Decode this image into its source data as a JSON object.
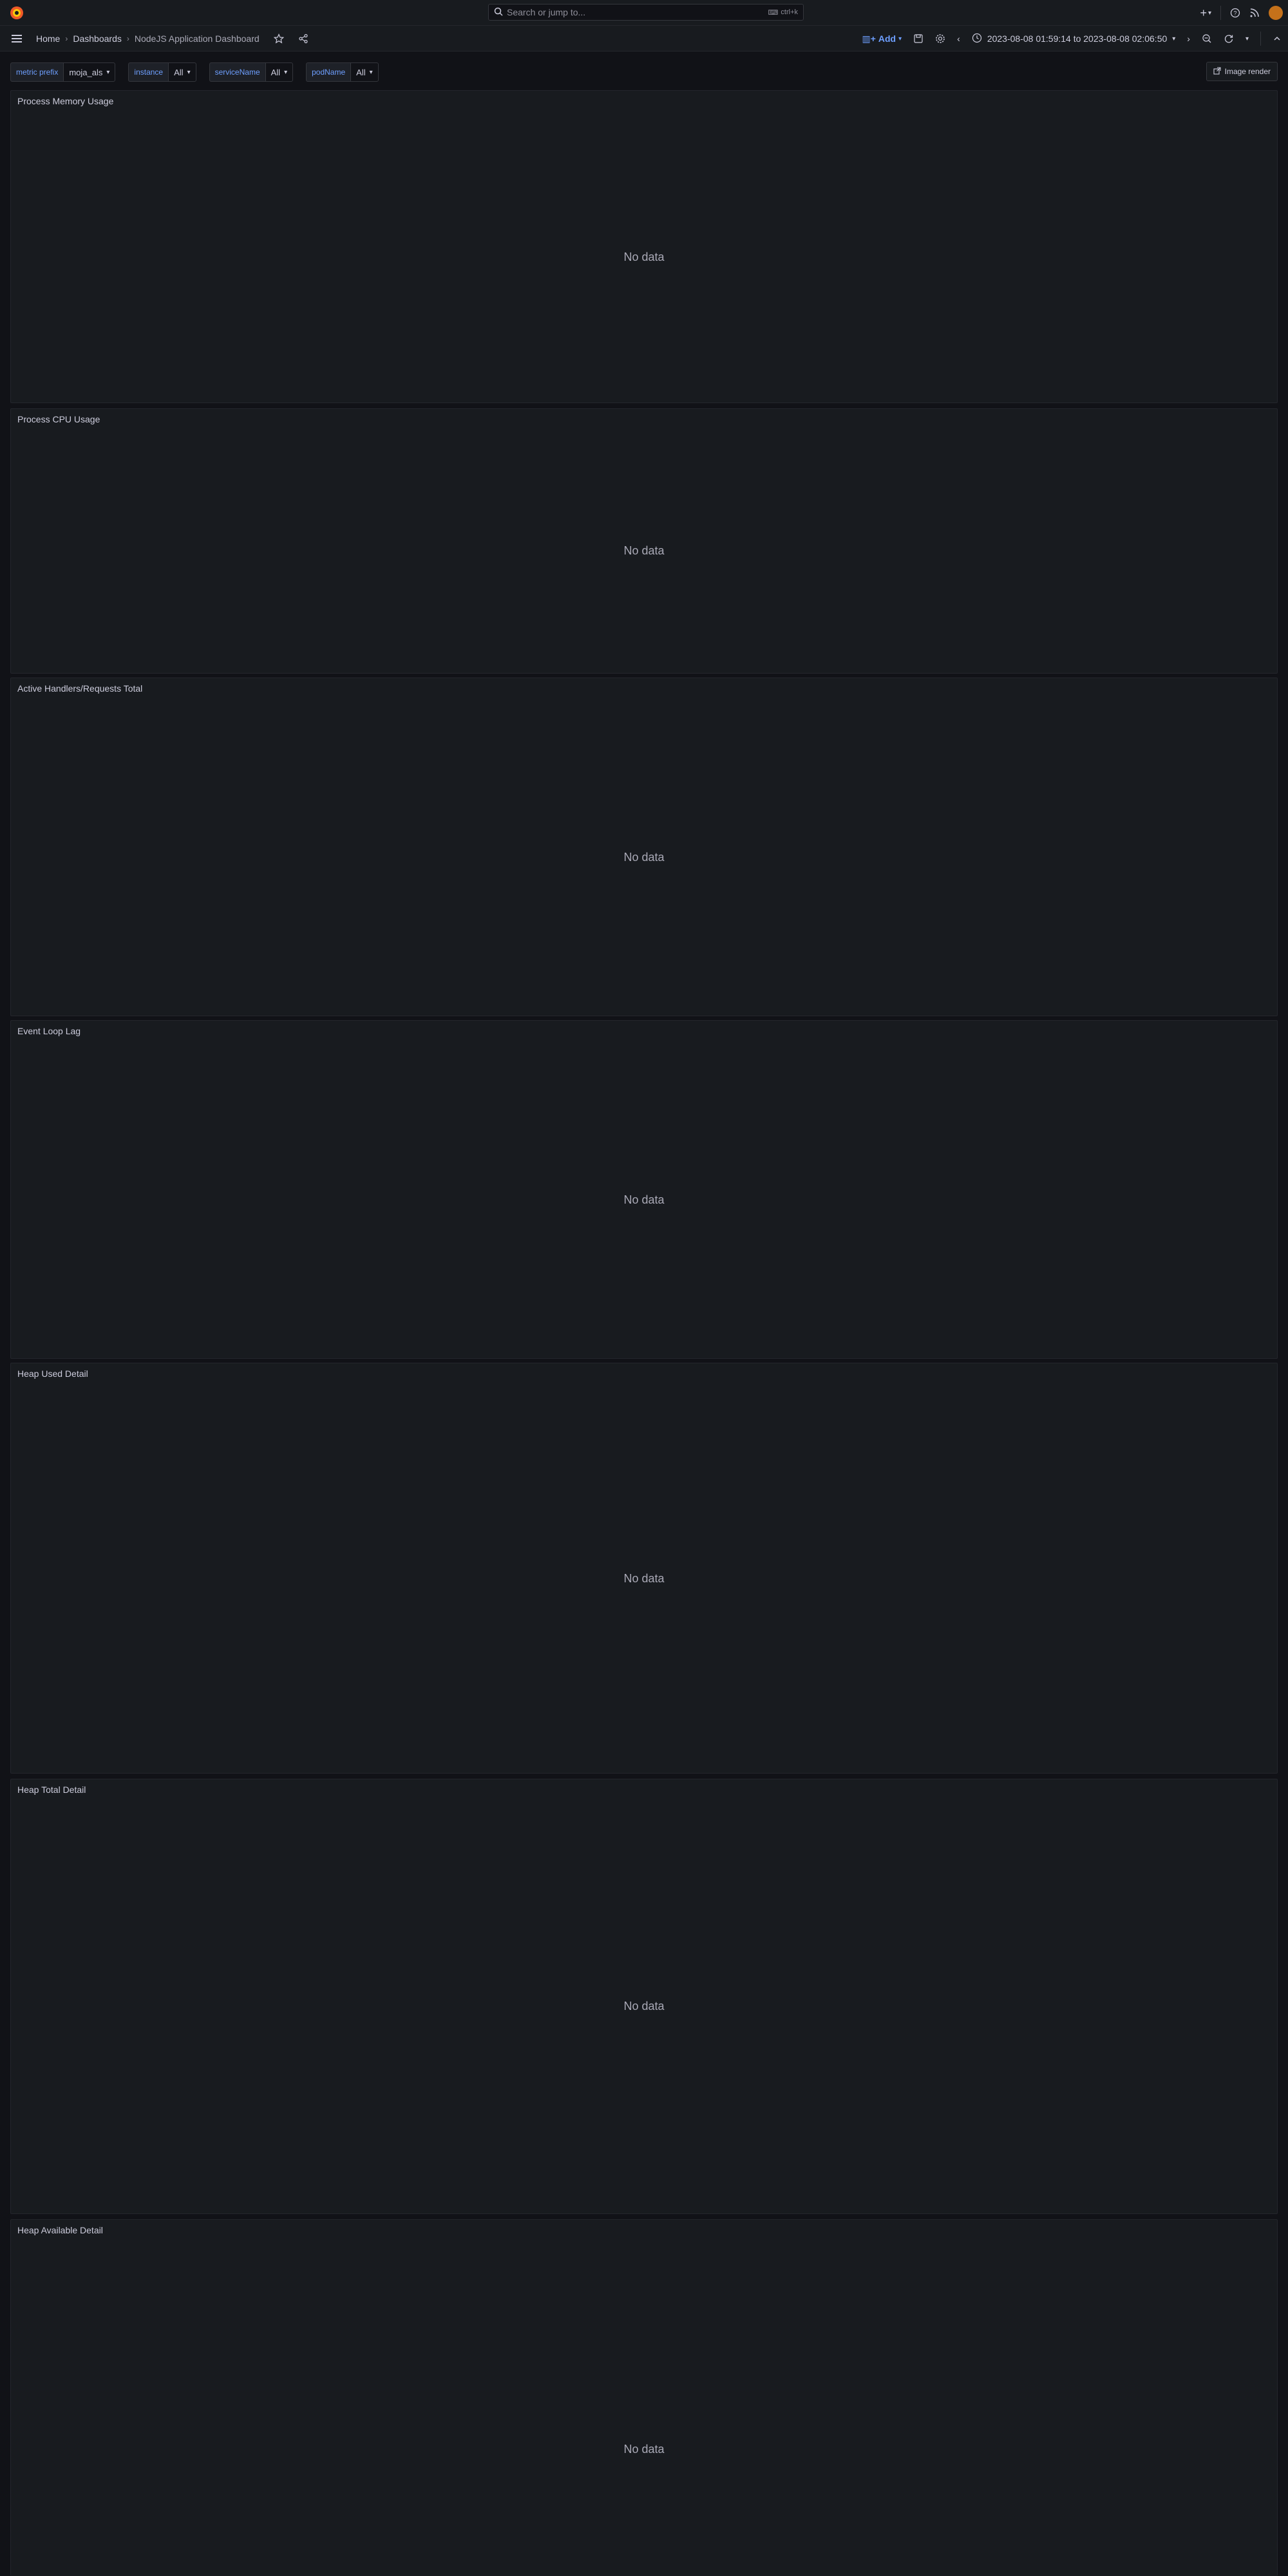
{
  "search": {
    "placeholder": "Search or jump to...",
    "shortcut": "ctrl+k"
  },
  "breadcrumb": {
    "home": "Home",
    "dashboards": "Dashboards",
    "current": "NodeJS Application Dashboard"
  },
  "toolbar": {
    "add_label": "Add",
    "time_range": "2023-08-08 01:59:14 to 2023-08-08 02:06:50"
  },
  "variables": [
    {
      "label": "metric prefix",
      "value": "moja_als"
    },
    {
      "label": "instance",
      "value": "All"
    },
    {
      "label": "serviceName",
      "value": "All"
    },
    {
      "label": "podName",
      "value": "All"
    }
  ],
  "image_render_label": "Image render",
  "no_data_text": "No data",
  "panels": [
    {
      "title": "Process Memory Usage"
    },
    {
      "title": "Process CPU Usage"
    },
    {
      "title": "Active Handlers/Requests Total"
    },
    {
      "title": "Event Loop Lag"
    },
    {
      "title": "Heap Used Detail"
    },
    {
      "title": "Heap Total Detail"
    },
    {
      "title": "Heap Available Detail"
    }
  ],
  "colors": {
    "accent": "#6e9fff",
    "logo": "#f05a28",
    "background": "#111217",
    "panel": "#181b1f"
  }
}
